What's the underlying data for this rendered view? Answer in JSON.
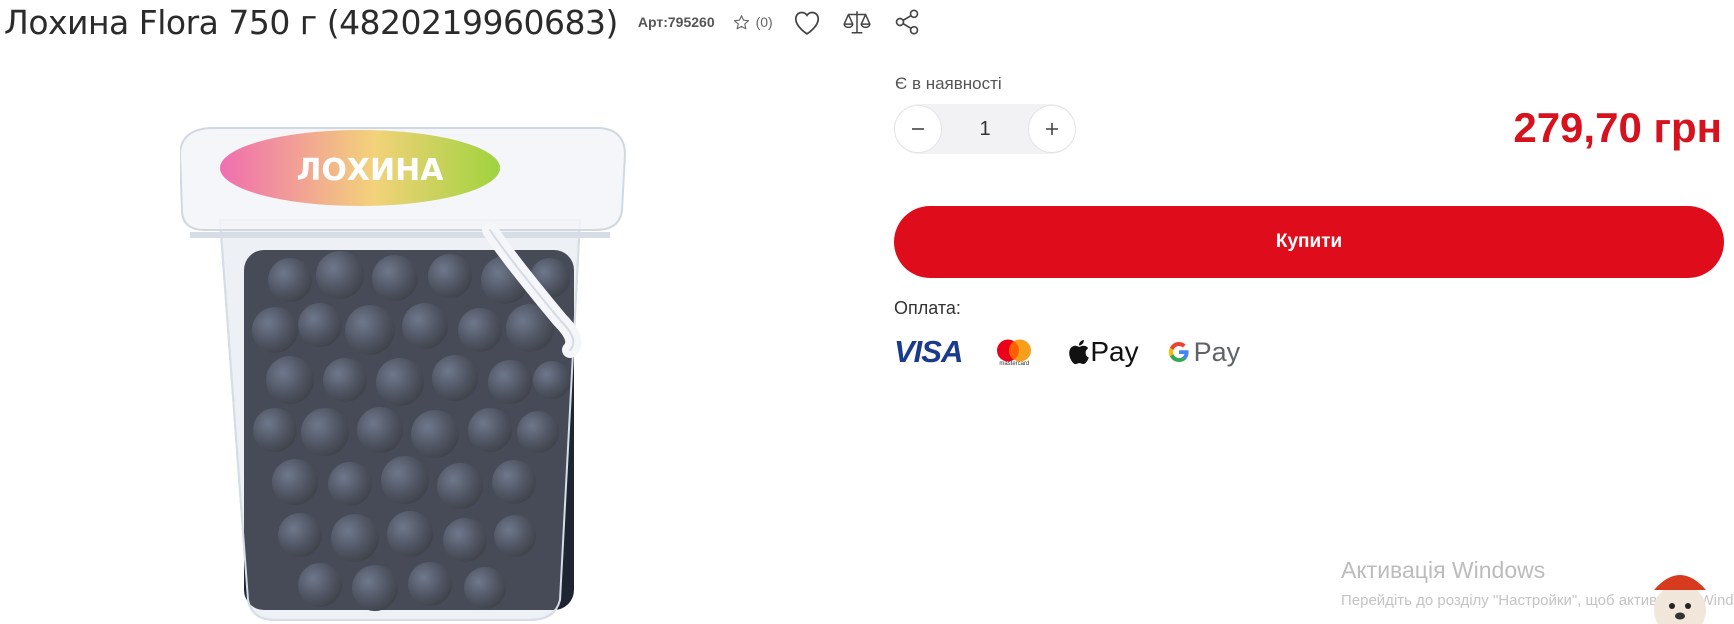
{
  "product": {
    "title": "Лохина Flora 750 г (4820219960683)",
    "sku": "Арт:795260",
    "rating_count": "(0)"
  },
  "icons": [
    "star-icon",
    "heart-icon",
    "compare-scales-icon",
    "share-icon",
    "minus-icon",
    "plus-icon",
    "apple-icon",
    "google-g-icon"
  ],
  "purchase": {
    "stock": "Є в наявності",
    "quantity": "1",
    "price": "279,70 грн",
    "buy_label": "Купити"
  },
  "payment": {
    "label": "Оплата:",
    "visa": "VISA",
    "mastercard": "mastercard",
    "apple_pay": "Pay",
    "google_pay": "Pay"
  },
  "image_label": "ЛОХИНА",
  "windows_notice": {
    "title": "Активація Windows",
    "subtitle": "Перейдіть до розділу \"Настройки\", щоб активувати Windows"
  },
  "colors": {
    "accent": "#df0c1b",
    "price": "#d5121e",
    "visa": "#1a3a8e",
    "mc_red": "#eb001b",
    "mc_orange": "#f79e1b"
  }
}
